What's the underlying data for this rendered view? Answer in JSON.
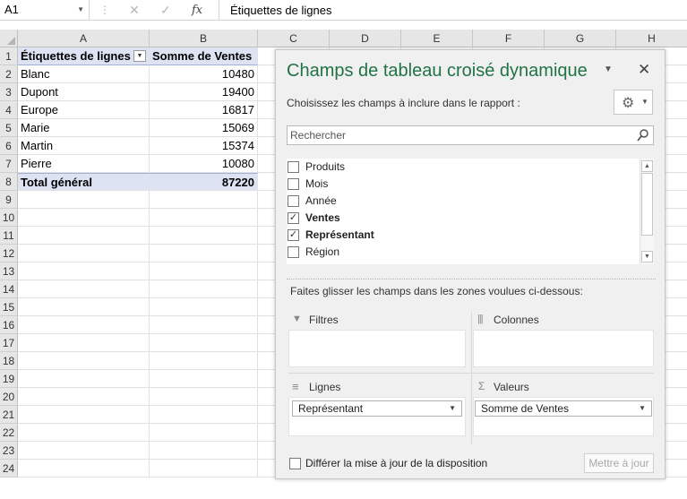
{
  "formula_bar": {
    "name_box": "A1",
    "cancel_glyph": "✕",
    "enter_glyph": "✓",
    "fx_label": "fx",
    "content": "Étiquettes de lignes"
  },
  "sheet": {
    "columns": [
      "A",
      "B",
      "C",
      "D",
      "E",
      "F",
      "G",
      "H"
    ],
    "rows": [
      "1",
      "2",
      "3",
      "4",
      "5",
      "6",
      "7",
      "8",
      "9",
      "10",
      "11",
      "12",
      "13",
      "14",
      "15",
      "16",
      "17",
      "18",
      "19",
      "20",
      "21",
      "22",
      "23",
      "24"
    ],
    "pivot": {
      "header_row_labels": "Étiquettes de lignes",
      "header_sum": "Somme de Ventes",
      "filter_glyph": "▼",
      "data": [
        {
          "label": "Blanc",
          "value": "10480"
        },
        {
          "label": "Dupont",
          "value": "19400"
        },
        {
          "label": "Europe",
          "value": "16817"
        },
        {
          "label": "Marie",
          "value": "15069"
        },
        {
          "label": "Martin",
          "value": "15374"
        },
        {
          "label": "Pierre",
          "value": "10080"
        }
      ],
      "total_label": "Total général",
      "total_value": "87220"
    }
  },
  "pivot_pane": {
    "title": "Champs de tableau croisé dynamique",
    "menu_glyph": "▼",
    "close_glyph": "✕",
    "choose_label": "Choisissez les champs à inclure dans le rapport :",
    "gear_glyph": "⚙",
    "gear_caret": "▼",
    "search_placeholder": "Rechercher",
    "fields": [
      {
        "name": "Produits",
        "checked": false
      },
      {
        "name": "Mois",
        "checked": false
      },
      {
        "name": "Année",
        "checked": false
      },
      {
        "name": "Ventes",
        "checked": true
      },
      {
        "name": "Représentant",
        "checked": true
      },
      {
        "name": "Région",
        "checked": false
      }
    ],
    "check_glyph": "✓",
    "scroll_up_glyph": "▲",
    "scroll_down_glyph": "▼",
    "drag_instructions": "Faites glisser les champs dans les zones voulues ci-dessous:",
    "zones": {
      "filters": "Filtres",
      "columns": "Colonnes",
      "rows": "Lignes",
      "values": "Valeurs"
    },
    "zone_icons": {
      "filters": "▼",
      "columns": "|||",
      "rows": "≡",
      "values": "Σ"
    },
    "rows_item": "Représentant",
    "values_item": "Somme de Ventes",
    "pill_caret": "▼",
    "defer_label": "Différer la mise à jour de la disposition",
    "update_button": "Mettre à jour"
  },
  "colors": {
    "title_green": "#217346",
    "pivot_header_bg": "#dde3f3"
  }
}
